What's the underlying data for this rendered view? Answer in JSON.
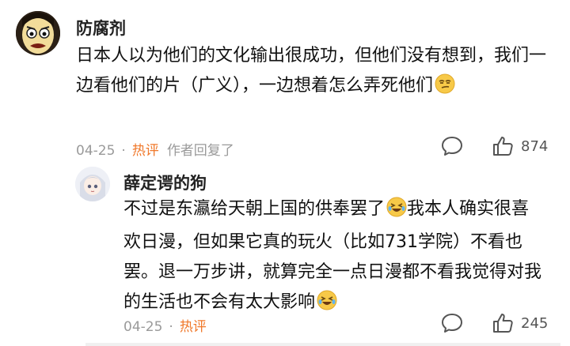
{
  "comments": [
    {
      "username": "防腐剂",
      "text": "日本人以为他们的文化输出很成功，但他们没有想到，我们一边看他们的片（广义），一边想着怎么弄死他们",
      "emoji": "smirk-emoji",
      "date": "04-25",
      "separator": "·",
      "tag": "热评",
      "note": "作者回复了",
      "likes": "874"
    },
    {
      "username": "薛定谔的狗",
      "text_part1": "不过是东瀛给天朝上国的供奉罢了",
      "text_part2": "我本人确实很喜欢日漫，但如果它真的玩火（比如731学院）不看也罢。退一万步讲，就算完全一点日漫都不看我觉得对我的生活也不会有太大影响",
      "emoji": "laughing-tears-emoji",
      "date": "04-25",
      "separator": "·",
      "tag": "热评",
      "likes": "245"
    }
  ],
  "colors": {
    "hot_tag": "#f0782a",
    "meta": "#9a9a9a"
  }
}
